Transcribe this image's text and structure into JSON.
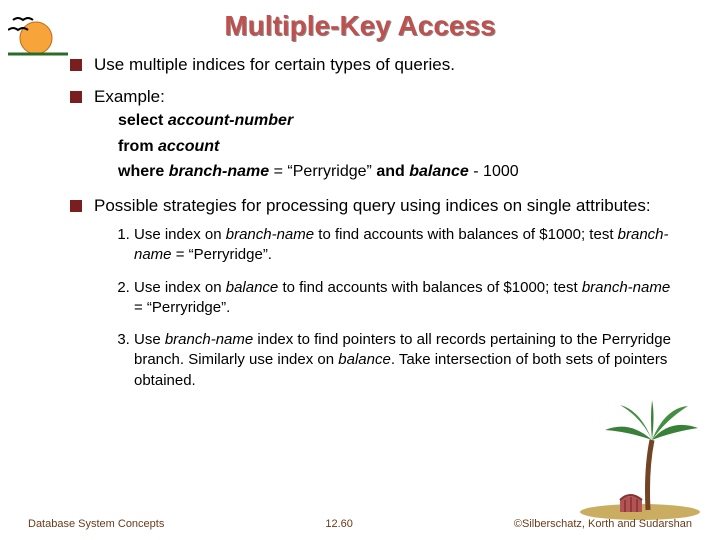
{
  "title": "Multiple-Key Access",
  "bullets": {
    "b1": "Use multiple indices for certain types of queries.",
    "b2": "Example:",
    "b3_pre": "Possible strategies for processing query using indices on single attributes:"
  },
  "sql": {
    "select_kw": "select",
    "select_id": "account-number",
    "from_kw": "from",
    "from_id": "account",
    "where_kw": "where",
    "where_id1": "branch-name",
    "where_mid": " = “Perryridge” ",
    "and_kw": "and",
    "where_id2": "balance",
    "where_tail": " - 1000"
  },
  "strategies": {
    "s1_a": "Use index on ",
    "s1_it1": "branch-name",
    "s1_b": " to find accounts with balances of $1000; test ",
    "s1_it2": "branch-name",
    "s1_c": " = “Perryridge”.",
    "s2_a": "Use index on ",
    "s2_it1": "balance",
    "s2_b": " to find accounts with balances of $1000; test ",
    "s2_it2": "branch-name",
    "s2_c": " = “Perryridge”.",
    "s3_a": "Use ",
    "s3_it1": "branch-name",
    "s3_b": " index to find pointers to all records pertaining to the Perryridge branch.  Similarly use index on ",
    "s3_it2": "balance",
    "s3_c": ".  Take intersection of both sets of pointers obtained."
  },
  "footer": {
    "left": "Database System Concepts",
    "center": "12.60",
    "right": "©Silberschatz, Korth and Sudarshan"
  }
}
